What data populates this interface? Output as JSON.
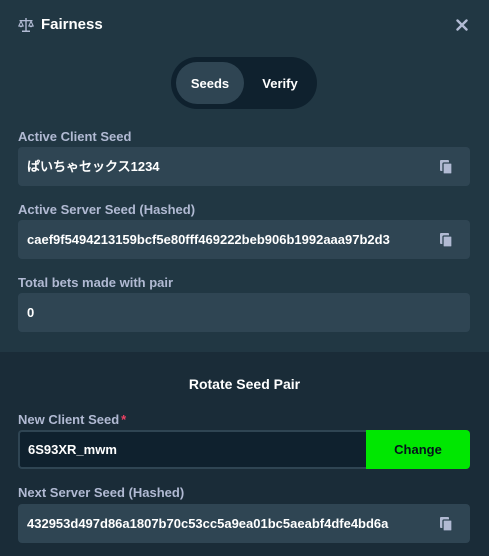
{
  "header": {
    "title": "Fairness",
    "title_icon": "scales-icon",
    "close_icon": "close-icon"
  },
  "tabs": [
    {
      "label": "Seeds",
      "active": true
    },
    {
      "label": "Verify",
      "active": false
    }
  ],
  "fields": {
    "active_client_seed": {
      "label": "Active Client Seed",
      "value": "ぱいちゃセックス1234"
    },
    "active_server_seed": {
      "label": "Active Server Seed (Hashed)",
      "value": "caef9f5494213159bcf5e80fff469222beb906b1992aaa97b2d3"
    },
    "total_bets": {
      "label": "Total bets made with pair",
      "value": "0"
    }
  },
  "rotate": {
    "title": "Rotate Seed Pair",
    "new_client_seed_label": "New Client Seed",
    "required_mark": "*",
    "new_client_seed_value": "6S93XR_mwm",
    "change_label": "Change",
    "next_server_seed_label": "Next Server Seed (Hashed)",
    "next_server_seed_value": "432953d497d86a1807b70c53cc5a9ea01bc5aeabf4dfe4bd6a"
  },
  "colors": {
    "background": "#213743",
    "field": "#2f4553",
    "section": "#1a2c38",
    "accent_green": "#00e701",
    "label": "#b1bad3",
    "required": "#ed4163"
  }
}
